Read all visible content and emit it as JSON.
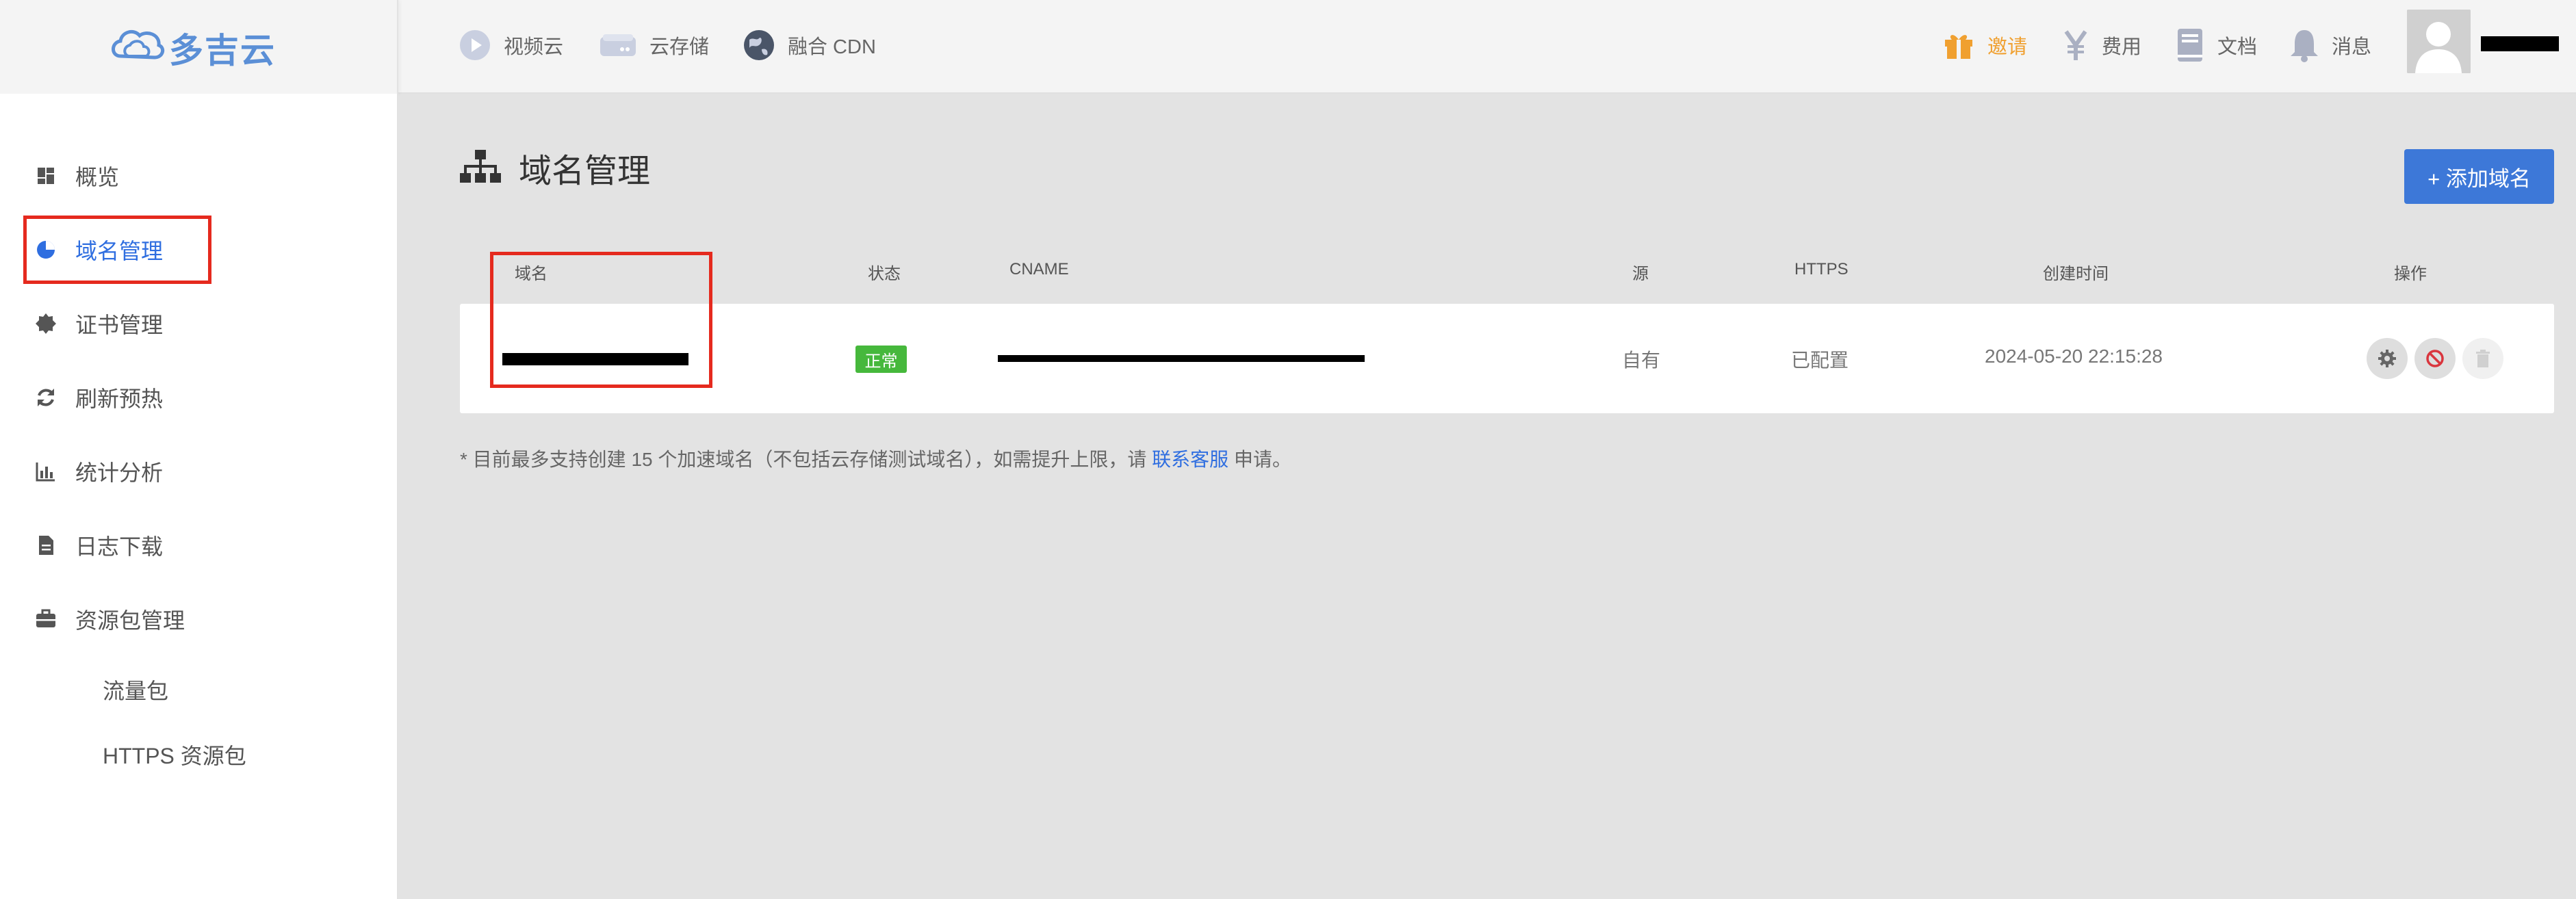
{
  "brand": {
    "name": "多吉云",
    "color": "#5b8fd6"
  },
  "topnav": {
    "left": [
      {
        "label": "视频云",
        "icon": "play-circle-icon"
      },
      {
        "label": "云存储",
        "icon": "storage-drive-icon"
      },
      {
        "label": "融合 CDN",
        "icon": "globe-icon"
      }
    ],
    "right": [
      {
        "label": "邀请",
        "icon": "gift-icon",
        "color": "#f0a030"
      },
      {
        "label": "费用",
        "icon": "yen-icon"
      },
      {
        "label": "文档",
        "icon": "book-icon"
      },
      {
        "label": "消息",
        "icon": "bell-icon"
      }
    ]
  },
  "sidebar": {
    "items": [
      {
        "label": "概览",
        "icon": "dashboard-icon"
      },
      {
        "label": "域名管理",
        "icon": "globe-pie-icon",
        "active": true
      },
      {
        "label": "证书管理",
        "icon": "certificate-icon"
      },
      {
        "label": "刷新预热",
        "icon": "refresh-icon"
      },
      {
        "label": "统计分析",
        "icon": "bar-chart-icon"
      },
      {
        "label": "日志下载",
        "icon": "file-icon"
      },
      {
        "label": "资源包管理",
        "icon": "briefcase-icon"
      }
    ],
    "subitems": [
      "流量包",
      "HTTPS 资源包"
    ]
  },
  "main": {
    "title": "域名管理",
    "title_icon": "sitemap-icon",
    "add_button": "+ 添加域名",
    "table": {
      "headers": [
        "域名",
        "状态",
        "CNAME",
        "源",
        "HTTPS",
        "创建时间",
        "操作"
      ],
      "rows": [
        {
          "status": "正常",
          "source": "自有",
          "https": "已配置",
          "created": "2024-05-20 22:15:28",
          "actions": [
            "settings-gear-icon",
            "disable-ban-icon",
            "delete-trash-icon"
          ]
        }
      ]
    },
    "note": {
      "prefix": "* 目前最多支持创建 15 个加速域名（不包括云存储测试域名），如需提升上限，请",
      "link": "联系客服",
      "suffix": "申请。"
    }
  },
  "colors": {
    "accent": "#3d78d8",
    "status_ok": "#46b83c",
    "highlight": "#e52a1e"
  }
}
